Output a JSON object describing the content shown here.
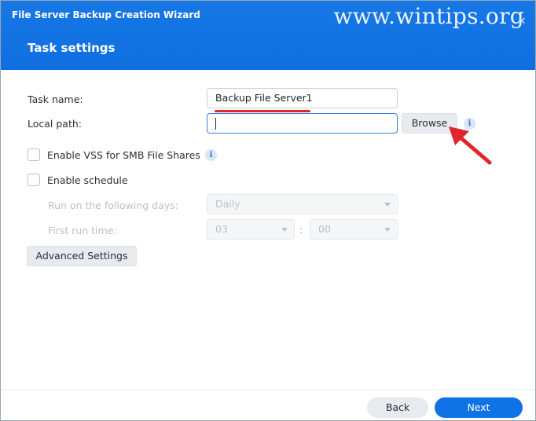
{
  "window": {
    "title": "File Server Backup Creation Wizard",
    "watermark": "www.wintips.org",
    "close_glyph": "✕"
  },
  "step": {
    "title": "Task settings"
  },
  "form": {
    "task_name_label": "Task name:",
    "task_name_value": "Backup File Server1",
    "local_path_label": "Local path:",
    "local_path_value": "",
    "browse_label": "Browse",
    "info_glyph": "i",
    "vss_label": "Enable VSS for SMB File Shares",
    "vss_checked": false,
    "schedule_label": "Enable schedule",
    "schedule_checked": false,
    "run_days_label": "Run on the following days:",
    "run_days_value": "Daily",
    "first_run_label": "First run time:",
    "hour_value": "03",
    "time_separator": ":",
    "minute_value": "00",
    "advanced_label": "Advanced Settings"
  },
  "footer": {
    "back_label": "Back",
    "next_label": "Next"
  },
  "colors": {
    "header": "#1677e5",
    "primary_button": "#0f72e5",
    "annotation": "#e0262b"
  },
  "icons": {
    "close": "close-icon",
    "info": "info-icon",
    "dropdown": "chevron-down-icon",
    "annotation": "red-arrow-icon"
  }
}
